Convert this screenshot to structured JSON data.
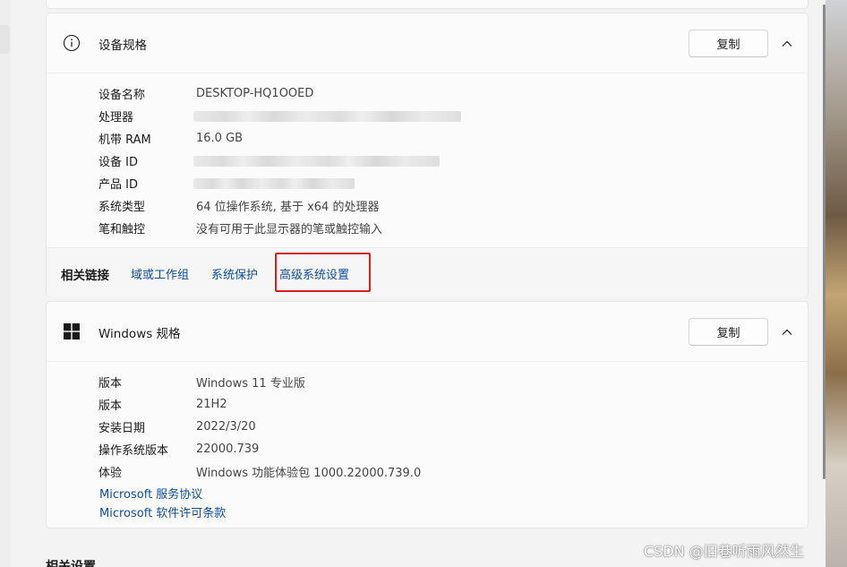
{
  "device_spec": {
    "title": "设备规格",
    "copy_label": "复制",
    "rows": [
      {
        "key": "设备名称",
        "value": "DESKTOP-HQ1OOED"
      },
      {
        "key": "处理器",
        "value": ""
      },
      {
        "key": "机带 RAM",
        "value": "16.0 GB"
      },
      {
        "key": "设备 ID",
        "value": ""
      },
      {
        "key": "产品 ID",
        "value": ""
      },
      {
        "key": "系统类型",
        "value": "64 位操作系统, 基于 x64 的处理器"
      },
      {
        "key": "笔和触控",
        "value": "没有可用于此显示器的笔或触控输入"
      }
    ],
    "related_links": {
      "label": "相关链接",
      "links": [
        "域或工作组",
        "系统保护",
        "高级系统设置"
      ]
    }
  },
  "windows_spec": {
    "title": "Windows 规格",
    "copy_label": "复制",
    "rows": [
      {
        "key": "版本",
        "value": "Windows 11 专业版"
      },
      {
        "key": "版本",
        "value": "21H2"
      },
      {
        "key": "安装日期",
        "value": "2022/3/20"
      },
      {
        "key": "操作系统版本",
        "value": "22000.739"
      },
      {
        "key": "体验",
        "value": "Windows 功能体验包 1000.22000.739.0"
      }
    ],
    "links": [
      "Microsoft 服务协议",
      "Microsoft 软件许可条款"
    ]
  },
  "bottom_heading": "相关设置",
  "watermark": "CSDN @旧巷听雨风然生",
  "colors": {
    "link": "#0f4c97",
    "highlight_border": "#d9201f",
    "background": "#f3f3f3",
    "card": "#fbfbfb"
  },
  "icons": {
    "device_spec": "info-icon",
    "windows_spec": "windows-logo-icon",
    "collapse": "chevron-up-icon"
  }
}
